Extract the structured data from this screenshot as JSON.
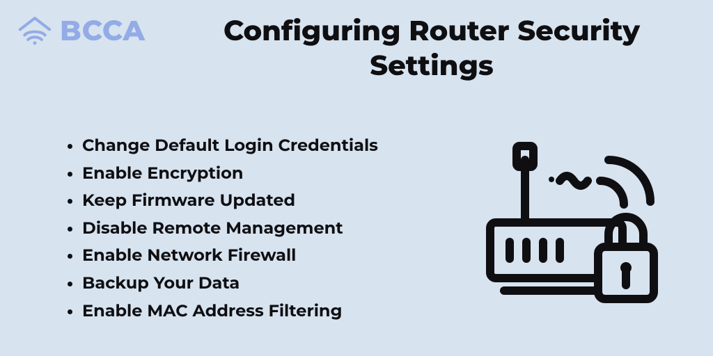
{
  "brand": {
    "name": "BCCA",
    "logo_icon": "wifi-house-icon"
  },
  "title": "Configuring Router Security Settings",
  "bullets": [
    "Change Default Login Credentials",
    "Enable Encryption",
    "Keep Firmware Updated",
    "Disable Remote Management",
    "Enable Network Firewall",
    "Backup Your Data",
    "Enable MAC Address Filtering"
  ],
  "illustration": "router-lock-wifi-icon",
  "colors": {
    "background": "#d7e3ef",
    "text": "#0f0f12",
    "brand": "#93abe6"
  }
}
